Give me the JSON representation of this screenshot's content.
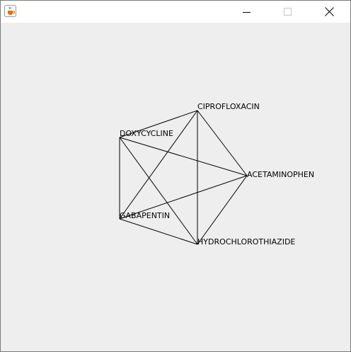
{
  "window": {
    "title": "",
    "app_icon": "java-coffee-cup-icon",
    "controls": [
      "minimize-icon",
      "maximize-icon",
      "close-icon"
    ]
  },
  "graph": {
    "nodes": [
      {
        "id": "cipro",
        "label": "CIPROFLOXACIN"
      },
      {
        "id": "doxy",
        "label": "DOXYCYCLINE"
      },
      {
        "id": "acet",
        "label": "ACETAMINOPHEN"
      },
      {
        "id": "gaba",
        "label": "GABAPENTIN"
      },
      {
        "id": "hctz",
        "label": "HYDROCHLOROTHIAZIDE"
      }
    ],
    "edges": [
      [
        "cipro",
        "doxy"
      ],
      [
        "cipro",
        "acet"
      ],
      [
        "cipro",
        "gaba"
      ],
      [
        "cipro",
        "hctz"
      ],
      [
        "doxy",
        "acet"
      ],
      [
        "doxy",
        "gaba"
      ],
      [
        "doxy",
        "hctz"
      ],
      [
        "acet",
        "gaba"
      ],
      [
        "acet",
        "hctz"
      ],
      [
        "gaba",
        "hctz"
      ]
    ],
    "line_color": "#000000"
  }
}
